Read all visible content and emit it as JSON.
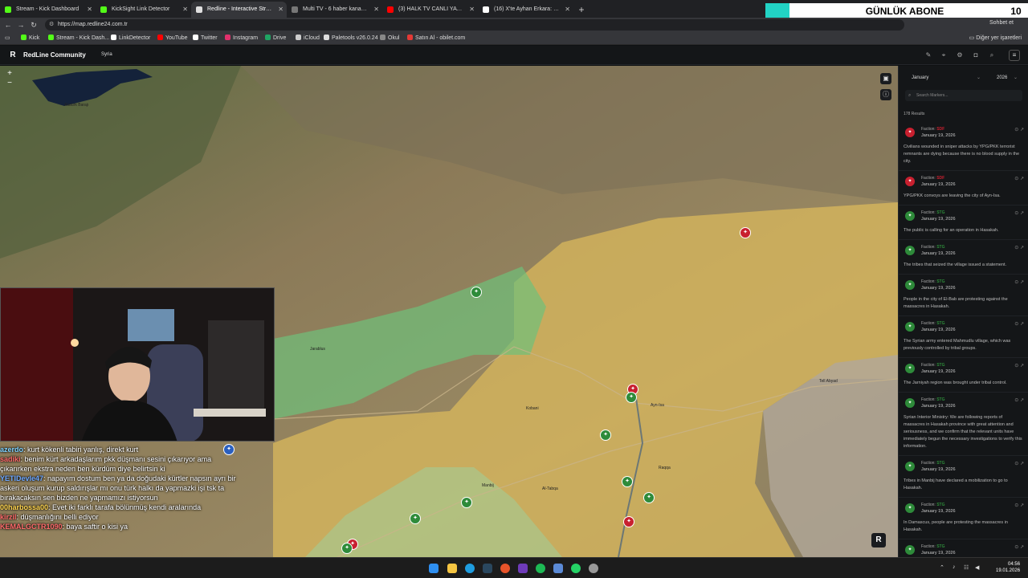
{
  "browser": {
    "tabs": [
      {
        "label": "Stream - Kick Dashboard",
        "color": "#53fc18"
      },
      {
        "label": "KickSight Link Detector",
        "color": "#53fc18"
      },
      {
        "label": "Redline - Interactive Strategic Map",
        "color": "#e0e0e0",
        "active": true
      },
      {
        "label": "Multi TV - 6 haber kanalını aynı anda izle",
        "color": "#777777"
      },
      {
        "label": "(3) HALK TV CANLI YAYINI | FULL HD",
        "color": "#ff0000"
      },
      {
        "label": "(16) X'te Ayhan Erkara: \"Haseke'de",
        "color": "#ffffff"
      }
    ],
    "new_tab": "+",
    "url": "https://map.redline24.com.tr",
    "profile_button": "Sohbet et",
    "bookmarks": [
      {
        "label": "Kick",
        "color": "#53fc18"
      },
      {
        "label": "Stream - Kick Dash...",
        "color": "#53fc18"
      },
      {
        "label": "LinkDetector",
        "color": "#ffffff"
      },
      {
        "label": "YouTube",
        "color": "#ff0000"
      },
      {
        "label": "Twitter",
        "color": "#ffffff"
      },
      {
        "label": "Instagram",
        "color": "#e1306c"
      },
      {
        "label": "Drive",
        "color": "#1fa463"
      },
      {
        "label": "iCloud",
        "color": "#cccccc"
      },
      {
        "label": "Paletools v26.0.24",
        "color": "#dddddd"
      },
      {
        "label": "Okul",
        "color": "#888888"
      },
      {
        "label": "Satın Al - obilet.com",
        "color": "#e53935"
      }
    ],
    "other_bookmarks": "Diğer yer işaretleri"
  },
  "overlay": {
    "banner_label": "GÜNLÜK ABONE",
    "banner_count": "10"
  },
  "app": {
    "logo": "R",
    "name": "RedLine Community",
    "nav": "Syria"
  },
  "sidebar": {
    "month": "January",
    "year": "2026",
    "search_placeholder": "Search Markers...",
    "results": "178 Results",
    "items": [
      {
        "faction": "SDF",
        "date": "January 19, 2026",
        "text": "Civilians wounded in sniper attacks by YPG/PKK terrorist remnants are dying because there is no blood supply in the city.",
        "color": "#c8202f"
      },
      {
        "faction": "SDF",
        "date": "January 19, 2026",
        "text": "YPG/PKK convoys are leaving the city of Ayn-Isa.",
        "color": "#c8202f"
      },
      {
        "faction": "STG",
        "date": "January 19, 2026",
        "text": "The public is calling for an operation in Hasakah.",
        "color": "#2e8b3a"
      },
      {
        "faction": "STG",
        "date": "January 19, 2026",
        "text": "The tribes that seized the village issued a statement.",
        "color": "#2e8b3a"
      },
      {
        "faction": "STG",
        "date": "January 19, 2026",
        "text": "People in the city of El-Bab are protesting against the massacres in Hasakah.",
        "color": "#2e8b3a"
      },
      {
        "faction": "STG",
        "date": "January 19, 2026",
        "text": "The Syrian army entered Mahmudlu village, which was previously controlled by tribal groups.",
        "color": "#2e8b3a"
      },
      {
        "faction": "STG",
        "date": "January 19, 2026",
        "text": "The Jarniyah region was brought under tribal control.",
        "color": "#2e8b3a"
      },
      {
        "faction": "STG",
        "date": "January 19, 2026",
        "text": "Syrian Interior Ministry: We are following reports of massacres in Hasakah province with great attention and seriousness, and we confirm that the relevant units have immediately begun the necessary investigations to verify this information.",
        "color": "#2e8b3a"
      },
      {
        "faction": "STG",
        "date": "January 19, 2026",
        "text": "Tribes in Manbij have declared a mobilization to go to Hasakah.",
        "color": "#2e8b3a"
      },
      {
        "faction": "STG",
        "date": "January 19, 2026",
        "text": "In Damascus, people are protesting the massacres in Hasakah.",
        "color": "#2e8b3a"
      },
      {
        "faction": "STG",
        "date": "January 19, 2026",
        "text": "",
        "color": "#2e8b3a"
      }
    ]
  },
  "map": {
    "zoom_in": "+",
    "zoom_out": "−",
    "badge": "R",
    "towns": [
      "Atatürk Barajı",
      "Kobani",
      "Jarablus",
      "Manbij",
      "Ayn-Isa",
      "Raqqa",
      "Al-Tabqa",
      "Tell Abyad"
    ]
  },
  "chat": [
    {
      "user": "azerdo",
      "text": ": kurt kökenli tabiri yanlış, direkt kurt",
      "color": "#7fd2ff"
    },
    {
      "user": "sadiki",
      "text": ": benim kürt arkadaşlarım pkk düşmanı sesini çıkarıyor ama çıkarırken ekstra neden ben kürdüm diye belirtsin ki",
      "color": "#ff6b6b"
    },
    {
      "user": "YETIDevle47",
      "text": ": napayım dostum ben ya da doğudaki kürtler napsın ayrı bir askeri oluşum kurup saldırışlar mı onu türk halkı da yapmazki işi tsk ta bırakacaksın sen bizden ne yapmamızı istiyorsun",
      "color": "#6ea8ff"
    },
    {
      "user": "00harbossa00",
      "text": ": Evet iki farklı tarafa bölünmüş kendi aralarında",
      "color": "#ffd54f"
    },
    {
      "user": "kirzil",
      "text": ": düşmanlığını belli ediyor",
      "color": "#ff6b6b"
    },
    {
      "user": "KEMALGCTR1090",
      "text": ": baya saftir o kisi ya",
      "color": "#ff6b6b"
    }
  ],
  "taskbar": {
    "time": "04:56",
    "date": "19.01.2026"
  }
}
